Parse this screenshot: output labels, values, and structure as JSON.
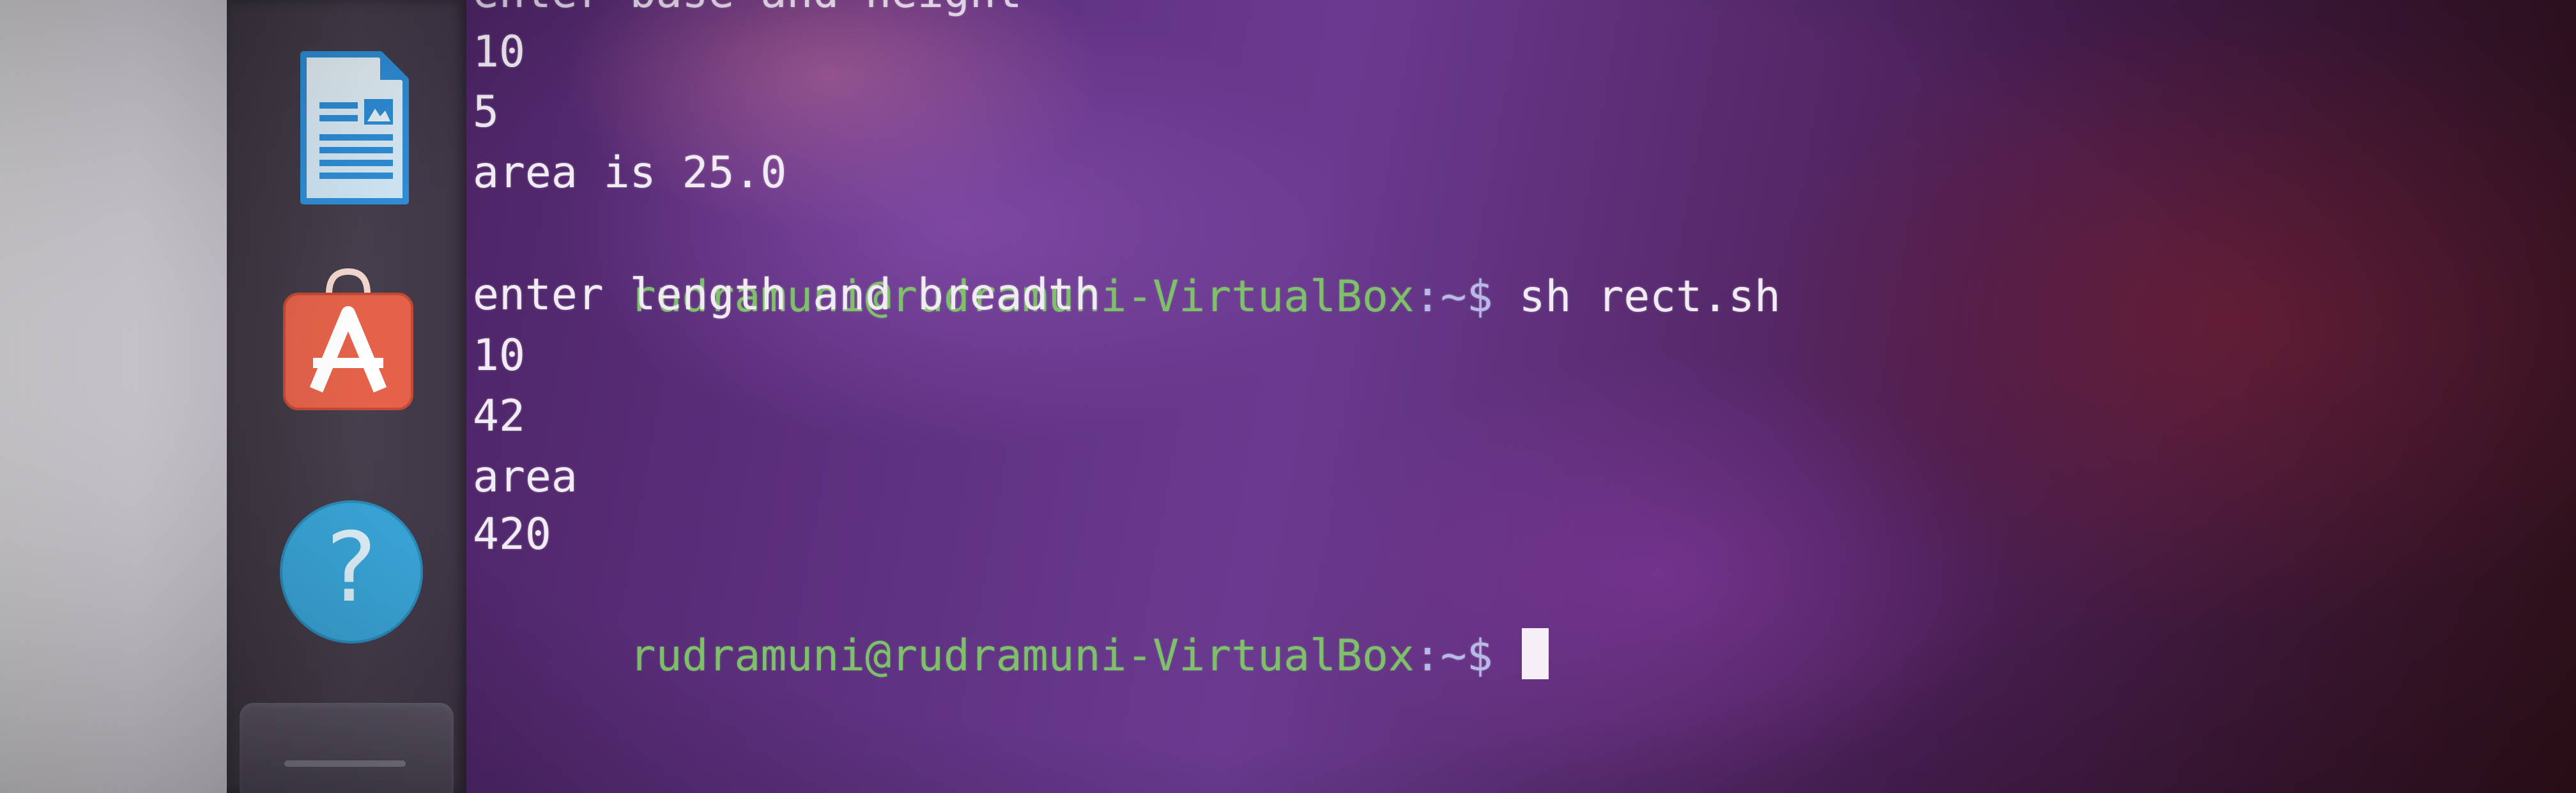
{
  "launcher": {
    "items": [
      {
        "name": "LibreOffice Writer",
        "icon": "document-writer-icon"
      },
      {
        "name": "Ubuntu Software",
        "icon": "software-center-icon",
        "glyph": "A"
      },
      {
        "name": "Help",
        "icon": "help-icon",
        "glyph": "?"
      }
    ]
  },
  "terminal": {
    "lines": [
      {
        "type": "output",
        "text": "enter base and height"
      },
      {
        "type": "output",
        "text": "10"
      },
      {
        "type": "output",
        "text": "5"
      },
      {
        "type": "output",
        "text": "area is 25.0"
      },
      {
        "type": "prompt",
        "user_host": "rudramuni@rudramuni-VirtualBox",
        "path": ":~$",
        "command": " sh rect.sh"
      },
      {
        "type": "output",
        "text": "enter length and breadth"
      },
      {
        "type": "output",
        "text": "10"
      },
      {
        "type": "output",
        "text": "42"
      },
      {
        "type": "output",
        "text": "area"
      },
      {
        "type": "output",
        "text": "420"
      },
      {
        "type": "prompt",
        "user_host": "rudramuni@rudramuni-VirtualBox",
        "path": ":~$",
        "command": " "
      }
    ]
  },
  "colors": {
    "prompt_user": "#7fc06a",
    "text": "#f1ecf4",
    "background_purple": "#5a2d7a",
    "writer_blue": "#2f8fd8",
    "software_orange": "#e5624a",
    "help_blue": "#3aa6d9"
  }
}
